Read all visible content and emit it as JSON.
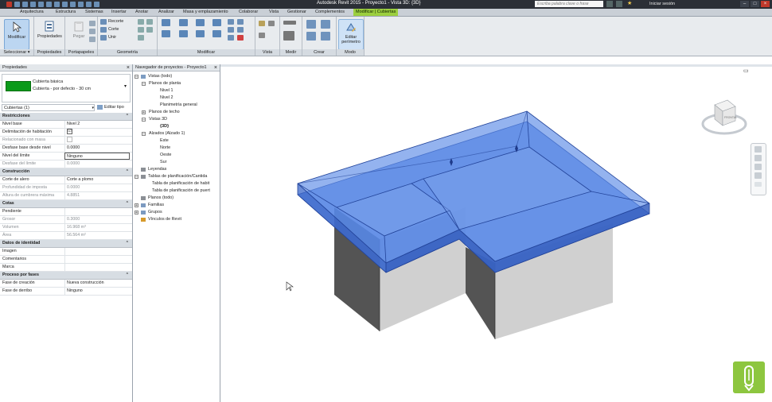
{
  "titlebar": {
    "title": "Autodesk Revit 2015 - Proyecto1 - Vista 3D: {3D}",
    "search_placeholder": "Escriba palabra clave o frase",
    "sign_in": "Iniciar sesión",
    "minimize": "–",
    "maximize": "□",
    "close": "×"
  },
  "tabs": [
    {
      "label": "Arquitectura"
    },
    {
      "label": "Estructura"
    },
    {
      "label": "Sistemas"
    },
    {
      "label": "Insertar"
    },
    {
      "label": "Anotar"
    },
    {
      "label": "Analizar"
    },
    {
      "label": "Masa y emplazamiento"
    },
    {
      "label": "Colaborar"
    },
    {
      "label": "Vista"
    },
    {
      "label": "Gestionar"
    },
    {
      "label": "Complementos"
    },
    {
      "label": "Modificar | Cubiertas"
    }
  ],
  "ribbon": {
    "modify": "Modificar",
    "select_panel": "Seleccionar ▾",
    "properties_btn": "Propiedades",
    "properties_panel": "Propiedades",
    "paste_btn": "Pegar",
    "clipboard_panel": "Portapapeles",
    "cope": "Recorte",
    "cut": "Corte",
    "join": "Unir",
    "geometry_panel": "Geometría",
    "modify_panel": "Modificar",
    "view_panel": "Vista",
    "measure_panel": "Medir",
    "create_panel": "Crear",
    "edit_footprint": "Editar perímetro",
    "mode_panel": "Modo"
  },
  "properties": {
    "header": "Propiedades",
    "close": "×",
    "type_family": "Cubierta básica",
    "type_name": "Cubierta - por defecto - 30 cm",
    "instance_selector": "Cubiertas (1)",
    "edit_type": "Editar tipo",
    "sections": [
      {
        "title": "Restricciones",
        "rows": [
          {
            "key": "Nivel base",
            "value": "Nivel 2"
          },
          {
            "key": "Delimitación de habitación",
            "value": "☑"
          },
          {
            "key": "Relacionado con masa",
            "value": ""
          },
          {
            "key": "Desfase base desde nivel",
            "value": "0.0000"
          },
          {
            "key": "Nivel del límite",
            "value": "Ninguno"
          },
          {
            "key": "Desfase del límite",
            "value": "0.0000"
          }
        ]
      },
      {
        "title": "Construcción",
        "rows": [
          {
            "key": "Corte de alero",
            "value": "Corte a plomo"
          },
          {
            "key": "Profundidad de imposta",
            "value": "0.0000"
          },
          {
            "key": "Altura de cumbrera máxima",
            "value": "4.8851"
          }
        ]
      },
      {
        "title": "Cotas",
        "rows": [
          {
            "key": "Pendiente",
            "value": ""
          },
          {
            "key": "Grosor",
            "value": "0.3000"
          },
          {
            "key": "Volumen",
            "value": "16.968 m³"
          },
          {
            "key": "Área",
            "value": "56.564 m²"
          }
        ]
      },
      {
        "title": "Datos de identidad",
        "rows": [
          {
            "key": "Imagen",
            "value": ""
          },
          {
            "key": "Comentarios",
            "value": ""
          },
          {
            "key": "Marca",
            "value": ""
          }
        ]
      },
      {
        "title": "Proceso por fases",
        "rows": [
          {
            "key": "Fase de creación",
            "value": "Nueva construcción"
          },
          {
            "key": "Fase de derribo",
            "value": "Ninguno"
          }
        ]
      }
    ]
  },
  "browser": {
    "header": "Navegador de proyectos - Proyecto1",
    "close": "×",
    "nodes": [
      {
        "label": "Vistas (todo)"
      },
      {
        "label": "Planos de planta"
      },
      {
        "label": "Nivel 1"
      },
      {
        "label": "Nivel 2"
      },
      {
        "label": "Planimetría general"
      },
      {
        "label": "Planos de techo"
      },
      {
        "label": "Vistas 3D"
      },
      {
        "label": "{3D}"
      },
      {
        "label": "Alzados (Alzado 1)"
      },
      {
        "label": "Este"
      },
      {
        "label": "Norte"
      },
      {
        "label": "Oeste"
      },
      {
        "label": "Sur"
      },
      {
        "label": "Leyendas"
      },
      {
        "label": "Tablas de planificación/Cantida"
      },
      {
        "label": "Tabla de planificación de habit"
      },
      {
        "label": "Tabla de planificación de puert"
      },
      {
        "label": "Planos (todo)"
      },
      {
        "label": "Familias"
      },
      {
        "label": "Grupos"
      },
      {
        "label": "Vínculos de Revit"
      }
    ]
  },
  "viewcube": {
    "face": "FRONTAL"
  },
  "colors": {
    "accent_tab": "#9ccf3f",
    "roof_fill": "#3f73d9",
    "type_swatch": "#0a9a1a"
  }
}
